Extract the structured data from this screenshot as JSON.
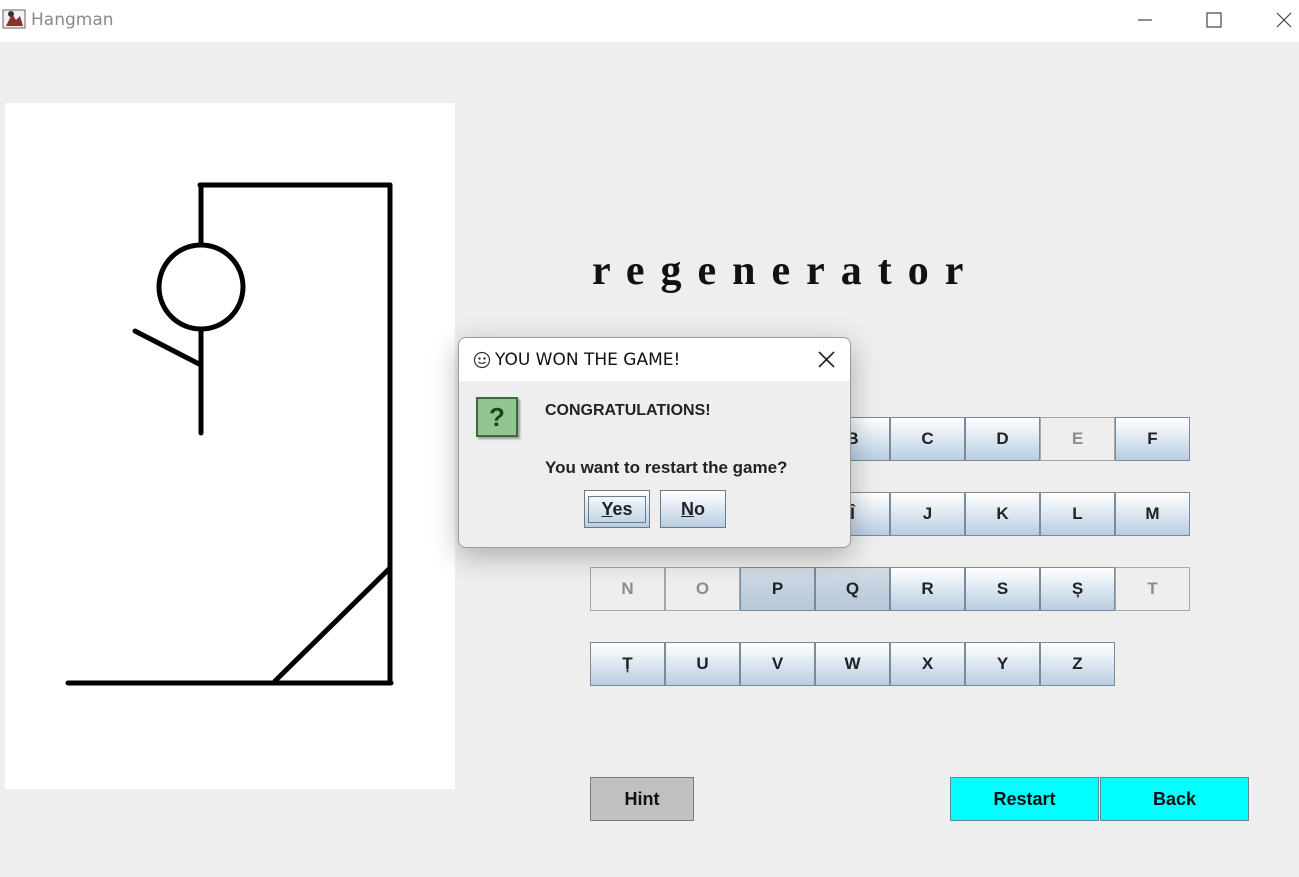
{
  "window": {
    "title": "Hangman",
    "controls": [
      "minimize-icon",
      "maximize-icon",
      "close-icon"
    ]
  },
  "game": {
    "word": "regenerator",
    "letters_row1": [
      {
        "label": "B",
        "state": "enabled"
      },
      {
        "label": "C",
        "state": "enabled"
      },
      {
        "label": "D",
        "state": "enabled"
      },
      {
        "label": "E",
        "state": "disabled"
      },
      {
        "label": "F",
        "state": "enabled"
      }
    ],
    "letters_row2": [
      {
        "label": "Î",
        "state": "enabled"
      },
      {
        "label": "J",
        "state": "enabled"
      },
      {
        "label": "K",
        "state": "enabled"
      },
      {
        "label": "L",
        "state": "enabled"
      },
      {
        "label": "M",
        "state": "enabled"
      }
    ],
    "letters_row3": [
      {
        "label": "N",
        "state": "disabled"
      },
      {
        "label": "O",
        "state": "disabled"
      },
      {
        "label": "P",
        "state": "pressed"
      },
      {
        "label": "Q",
        "state": "pressed"
      },
      {
        "label": "R",
        "state": "enabled"
      },
      {
        "label": "S",
        "state": "enabled"
      },
      {
        "label": "Ș",
        "state": "enabled"
      },
      {
        "label": "T",
        "state": "disabled"
      }
    ],
    "letters_row4": [
      {
        "label": "Ț",
        "state": "enabled"
      },
      {
        "label": "U",
        "state": "enabled"
      },
      {
        "label": "V",
        "state": "enabled"
      },
      {
        "label": "W",
        "state": "enabled"
      },
      {
        "label": "X",
        "state": "enabled"
      },
      {
        "label": "Y",
        "state": "enabled"
      },
      {
        "label": "Z",
        "state": "enabled"
      }
    ],
    "hint_label": "Hint",
    "restart_label": "Restart",
    "back_label": "Back",
    "accent_color": "#00ffff"
  },
  "dialog": {
    "title": "YOU WON THE GAME!",
    "message": "CONGRATULATIONS!",
    "question": "You want to restart the game?",
    "yes_mnemonic": "Y",
    "yes_rest": "es",
    "no_mnemonic": "N",
    "no_rest": "o",
    "icon": "question-icon",
    "icon_glyph": "?"
  }
}
